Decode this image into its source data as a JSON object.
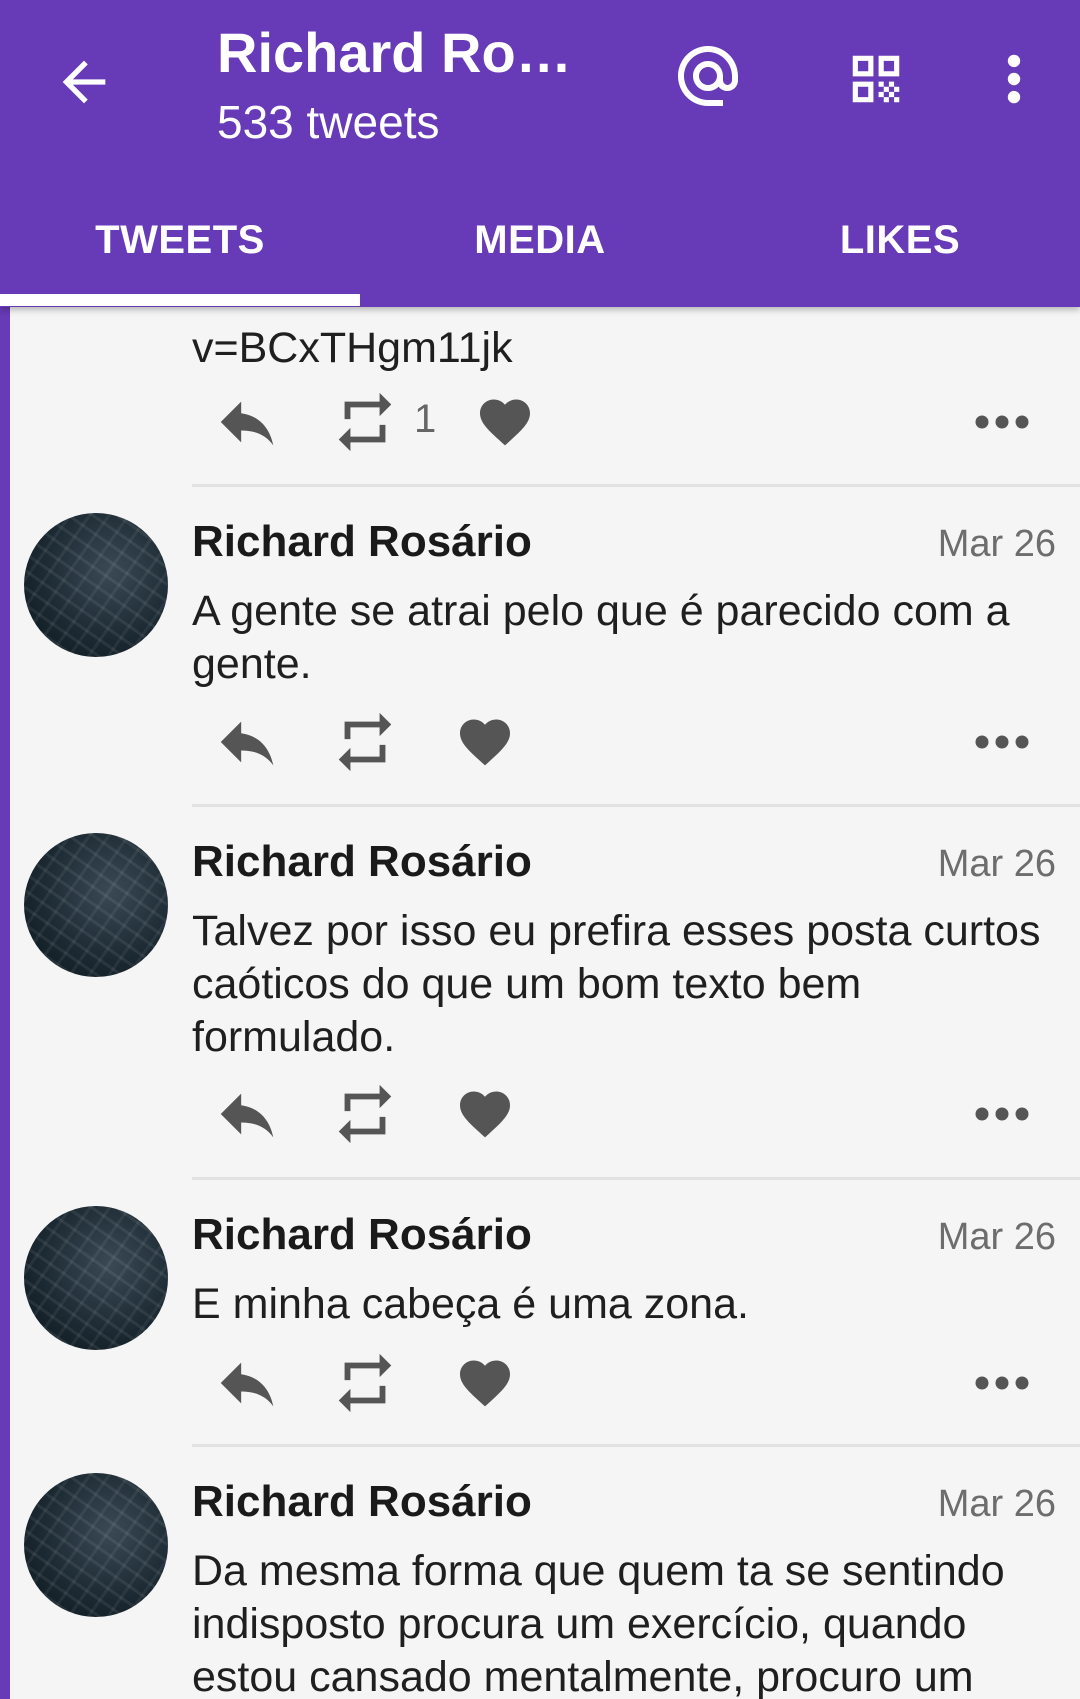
{
  "header": {
    "title": "Richard Ros…",
    "subtitle": "533 tweets"
  },
  "tabs": [
    {
      "label": "TWEETS",
      "active": true
    },
    {
      "label": "MEDIA",
      "active": false
    },
    {
      "label": "LIKES",
      "active": false
    }
  ],
  "tweets": [
    {
      "author": "",
      "date": "",
      "text": "v=BCxTHgm11jk",
      "retweets": "1"
    },
    {
      "author": "Richard Rosário",
      "date": "Mar 26",
      "text": "A gente se atrai pelo que é parecido com a gente.",
      "retweets": ""
    },
    {
      "author": "Richard Rosário",
      "date": "Mar 26",
      "text": "Talvez por isso eu prefira esses posta curtos caóticos do que um bom texto bem formulado.",
      "retweets": ""
    },
    {
      "author": "Richard Rosário",
      "date": "Mar 26",
      "text": "E minha cabeça é uma zona.",
      "retweets": ""
    },
    {
      "author": "Richard Rosário",
      "date": "Mar 26",
      "text": "Da mesma forma que quem ta se sentindo indisposto procura um exercício, quando estou cansado mentalmente, procuro um",
      "retweets": ""
    }
  ],
  "colors": {
    "primary": "#673ab7",
    "icon": "#555555"
  }
}
